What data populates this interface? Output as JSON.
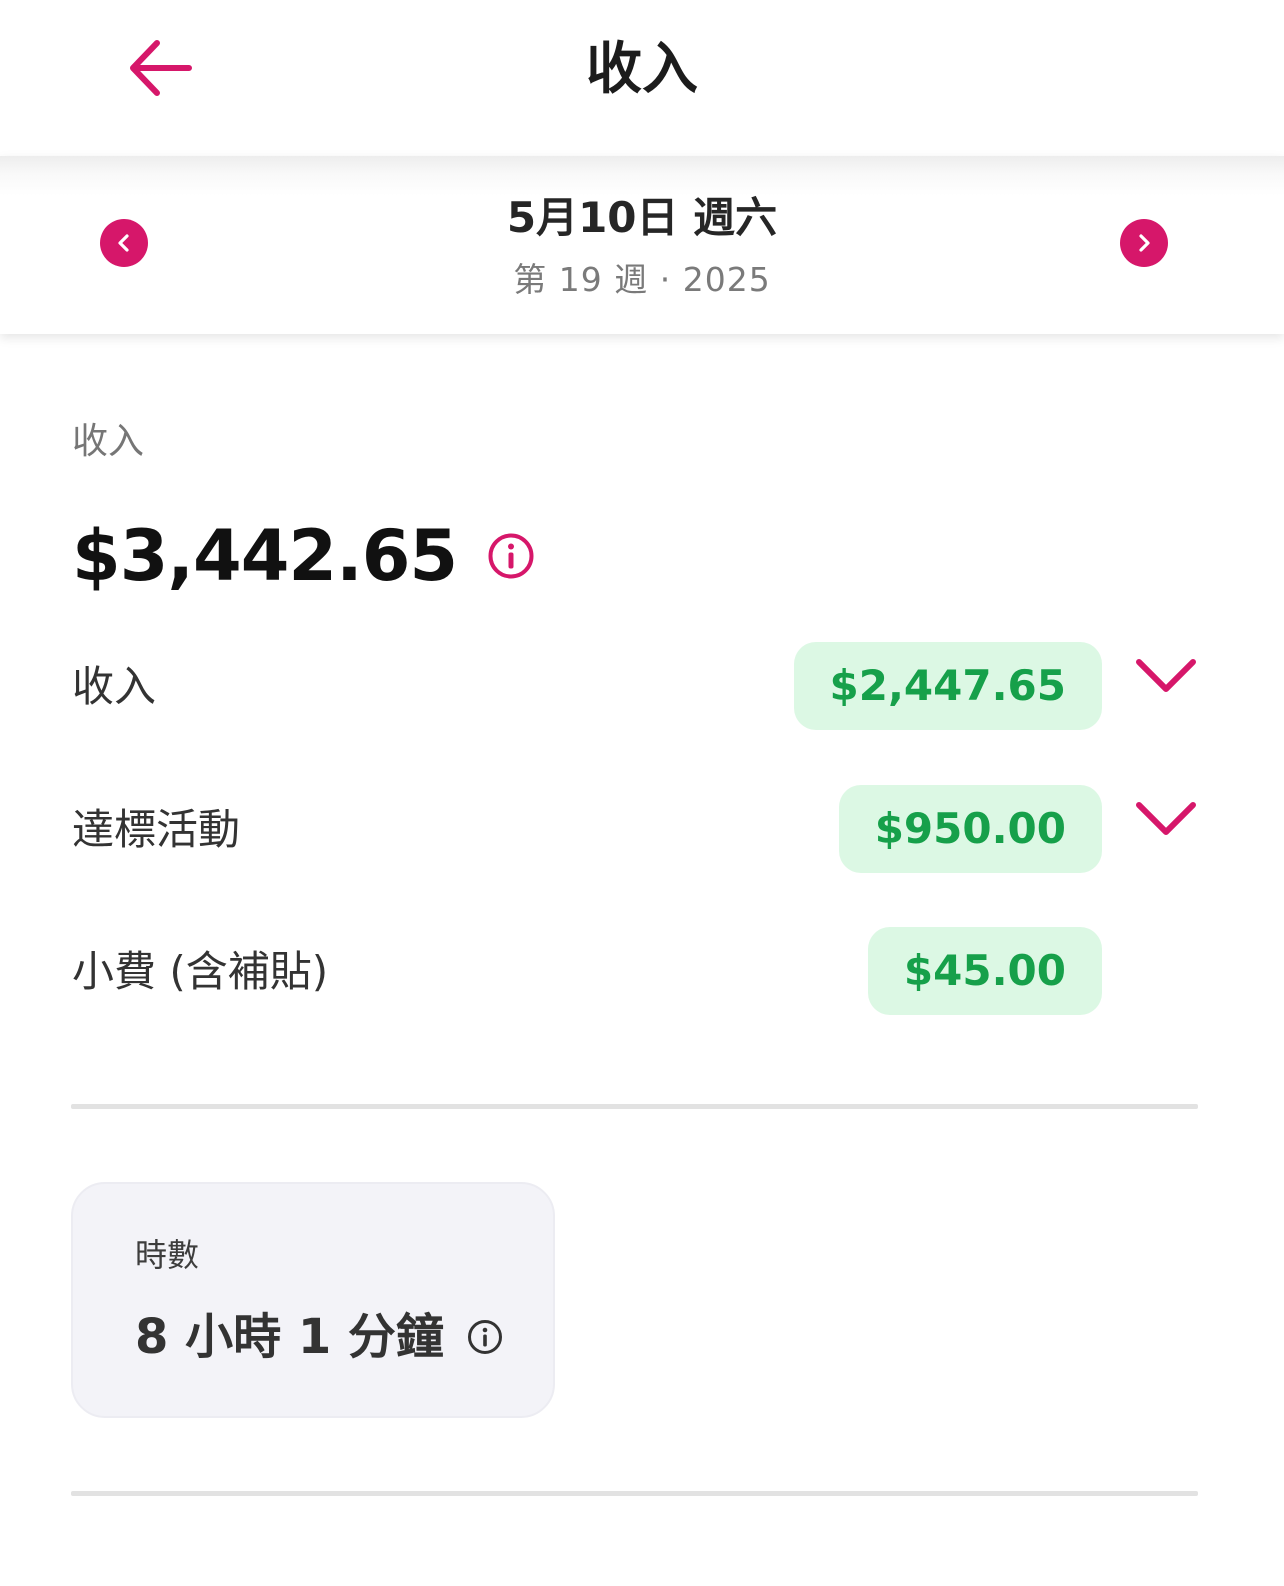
{
  "header": {
    "title": "收入",
    "back_icon": "arrow-left-icon"
  },
  "date_nav": {
    "date": "5月10日 週六",
    "week_year": "第 19 週 · 2025",
    "prev_icon": "chevron-left-icon",
    "next_icon": "chevron-right-icon"
  },
  "summary": {
    "label": "收入",
    "total": "$3,442.65",
    "info_icon": "info-icon"
  },
  "breakdown": [
    {
      "label": "收入",
      "amount": "$2,447.65",
      "expandable": true
    },
    {
      "label": "達標活動",
      "amount": "$950.00",
      "expandable": true
    },
    {
      "label": "小費 (含補貼)",
      "amount": "$45.00",
      "expandable": false
    }
  ],
  "hours_card": {
    "label": "時數",
    "value": "8 小時 1 分鐘",
    "info_icon": "info-icon"
  },
  "colors": {
    "accent": "#d6176a",
    "positive_text": "#16a04a",
    "positive_bg": "#dcf8e4",
    "card_bg": "#f3f3f8",
    "divider": "#e2e2e2"
  }
}
